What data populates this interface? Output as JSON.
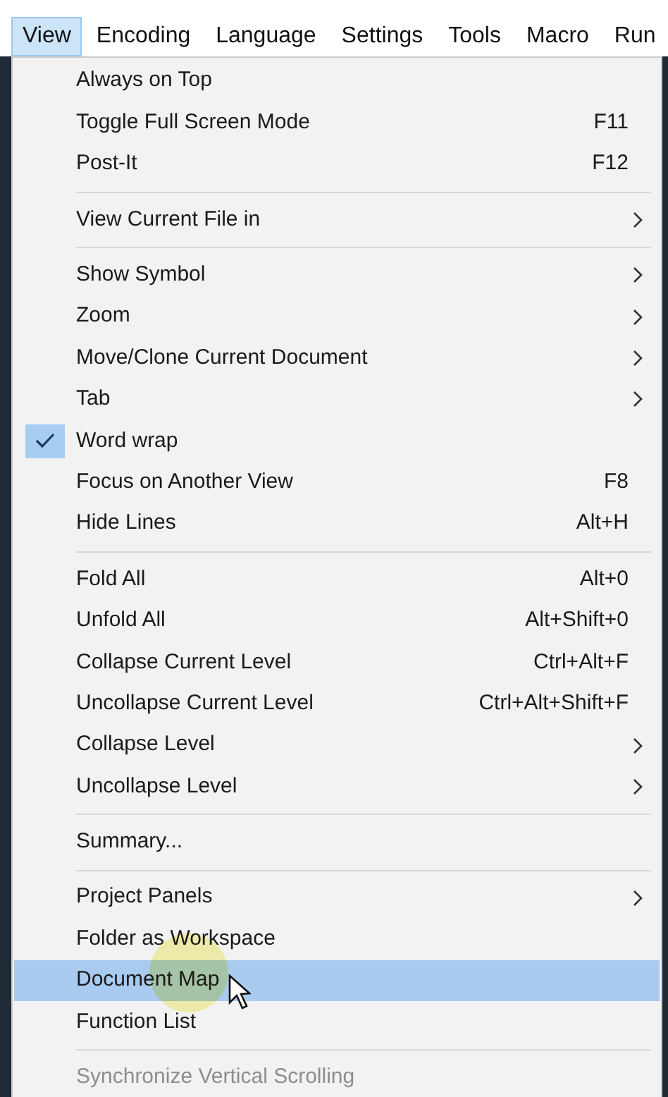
{
  "menubar": [
    {
      "label": "View",
      "selected": true
    },
    {
      "label": "Encoding",
      "selected": false
    },
    {
      "label": "Language",
      "selected": false
    },
    {
      "label": "Settings",
      "selected": false
    },
    {
      "label": "Tools",
      "selected": false
    },
    {
      "label": "Macro",
      "selected": false
    },
    {
      "label": "Run",
      "selected": false
    }
  ],
  "menu": [
    {
      "kind": "item",
      "label": "Always on Top",
      "checked": false,
      "submenu": false,
      "selected": false,
      "disabled": false
    },
    {
      "kind": "item",
      "label": "Toggle Full Screen Mode",
      "shortcut": "F11",
      "checked": false,
      "submenu": false,
      "selected": false,
      "disabled": false
    },
    {
      "kind": "item",
      "label": "Post-It",
      "shortcut": "F12",
      "checked": false,
      "submenu": false,
      "selected": false,
      "disabled": false
    },
    {
      "kind": "separator"
    },
    {
      "kind": "item",
      "label": "View Current File in",
      "checked": false,
      "submenu": true,
      "selected": false,
      "disabled": false
    },
    {
      "kind": "separator"
    },
    {
      "kind": "item",
      "label": "Show Symbol",
      "checked": false,
      "submenu": true,
      "selected": false,
      "disabled": false
    },
    {
      "kind": "item",
      "label": "Zoom",
      "checked": false,
      "submenu": true,
      "selected": false,
      "disabled": false
    },
    {
      "kind": "item",
      "label": "Move/Clone Current Document",
      "checked": false,
      "submenu": true,
      "selected": false,
      "disabled": false
    },
    {
      "kind": "item",
      "label": "Tab",
      "checked": false,
      "submenu": true,
      "selected": false,
      "disabled": false
    },
    {
      "kind": "item",
      "label": "Word wrap",
      "checked": true,
      "submenu": false,
      "selected": false,
      "disabled": false
    },
    {
      "kind": "item",
      "label": "Focus on Another View",
      "shortcut": "F8",
      "checked": false,
      "submenu": false,
      "selected": false,
      "disabled": false
    },
    {
      "kind": "item",
      "label": "Hide Lines",
      "shortcut": "Alt+H",
      "checked": false,
      "submenu": false,
      "selected": false,
      "disabled": false
    },
    {
      "kind": "separator"
    },
    {
      "kind": "item",
      "label": "Fold All",
      "shortcut": "Alt+0",
      "checked": false,
      "submenu": false,
      "selected": false,
      "disabled": false
    },
    {
      "kind": "item",
      "label": "Unfold All",
      "shortcut": "Alt+Shift+0",
      "checked": false,
      "submenu": false,
      "selected": false,
      "disabled": false
    },
    {
      "kind": "item",
      "label": "Collapse Current Level",
      "shortcut": "Ctrl+Alt+F",
      "checked": false,
      "submenu": false,
      "selected": false,
      "disabled": false
    },
    {
      "kind": "item",
      "label": "Uncollapse Current Level",
      "shortcut": "Ctrl+Alt+Shift+F",
      "checked": false,
      "submenu": false,
      "selected": false,
      "disabled": false
    },
    {
      "kind": "item",
      "label": "Collapse Level",
      "checked": false,
      "submenu": true,
      "selected": false,
      "disabled": false
    },
    {
      "kind": "item",
      "label": "Uncollapse Level",
      "checked": false,
      "submenu": true,
      "selected": false,
      "disabled": false
    },
    {
      "kind": "separator"
    },
    {
      "kind": "item",
      "label": "Summary...",
      "checked": false,
      "submenu": false,
      "selected": false,
      "disabled": false
    },
    {
      "kind": "separator"
    },
    {
      "kind": "item",
      "label": "Project Panels",
      "checked": false,
      "submenu": true,
      "selected": false,
      "disabled": false
    },
    {
      "kind": "item",
      "label": "Folder as Workspace",
      "checked": false,
      "submenu": false,
      "selected": false,
      "disabled": false
    },
    {
      "kind": "item",
      "label": "Document Map",
      "checked": false,
      "submenu": false,
      "selected": true,
      "disabled": false
    },
    {
      "kind": "item",
      "label": "Function List",
      "checked": false,
      "submenu": false,
      "selected": false,
      "disabled": false
    },
    {
      "kind": "separator"
    },
    {
      "kind": "item",
      "label": "Synchronize Vertical Scrolling",
      "checked": false,
      "submenu": false,
      "selected": false,
      "disabled": true
    }
  ]
}
